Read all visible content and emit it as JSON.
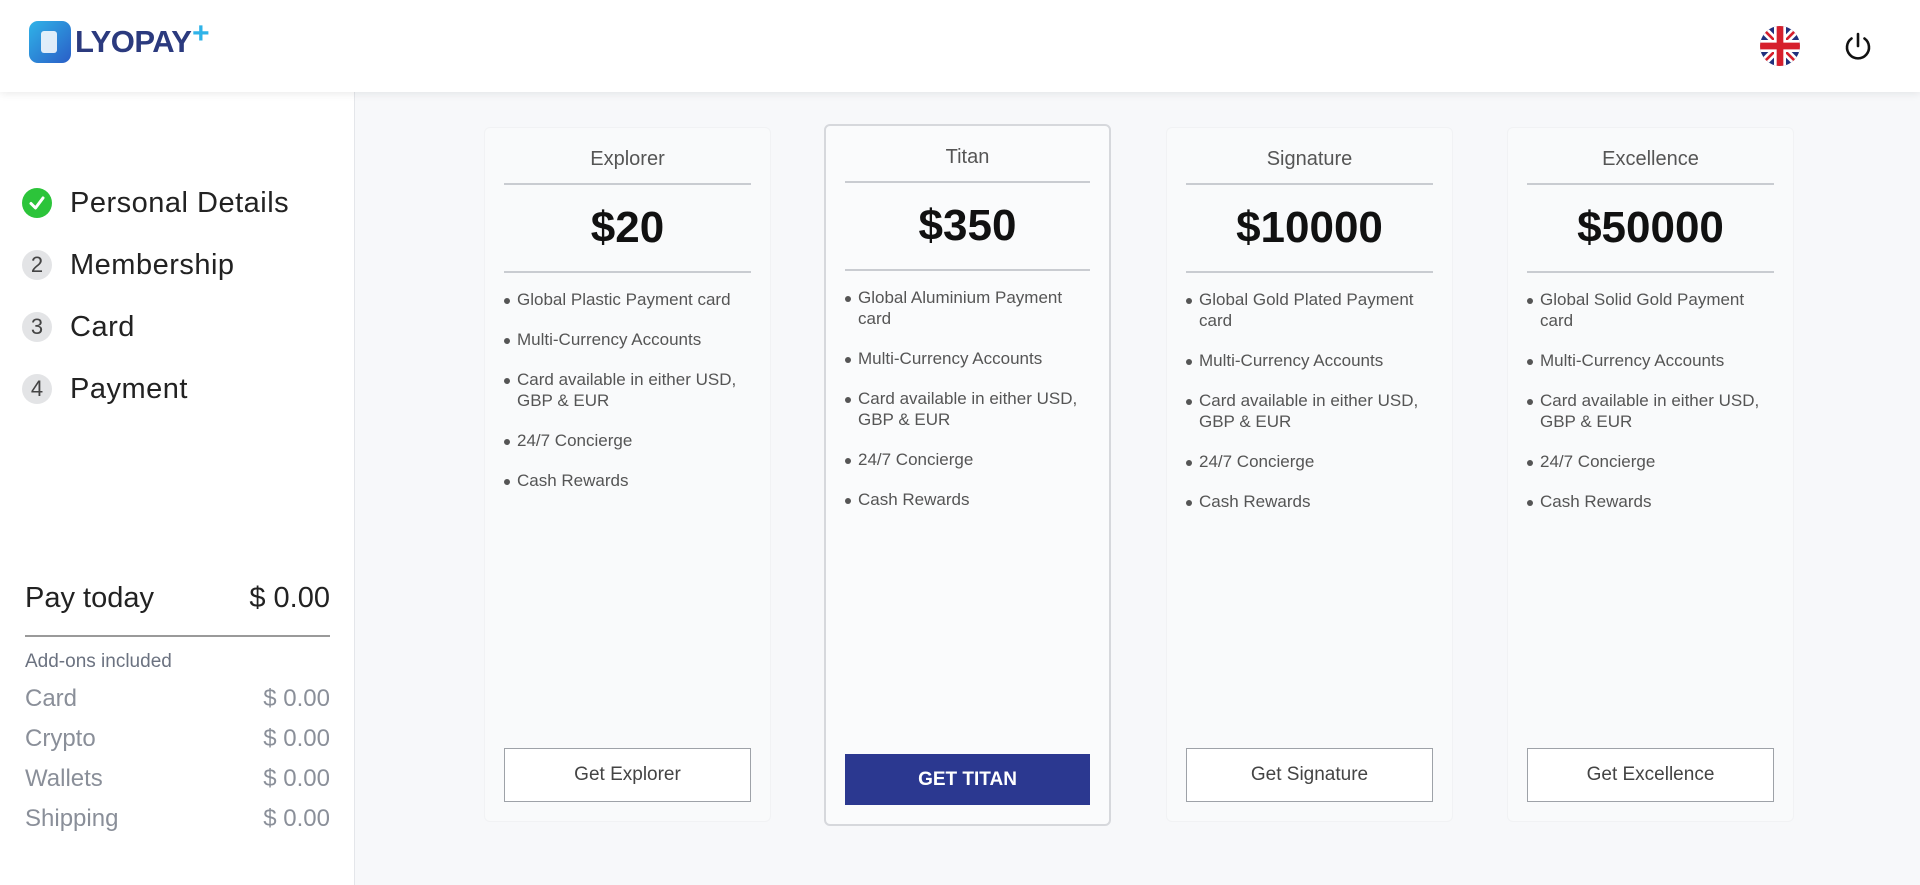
{
  "header": {
    "brand": "LYOPAY",
    "brand_plus": "+",
    "language_icon": "uk-flag-icon",
    "power_icon": "power-icon"
  },
  "sidebar": {
    "steps": [
      {
        "number": "1",
        "label": "Personal Details",
        "status": "completed"
      },
      {
        "number": "2",
        "label": "Membership",
        "status": "pending"
      },
      {
        "number": "3",
        "label": "Card",
        "status": "pending"
      },
      {
        "number": "4",
        "label": "Payment",
        "status": "pending"
      }
    ],
    "pay_today": {
      "label": "Pay today",
      "amount": "$ 0.00"
    },
    "addons_label": "Add-ons included",
    "addons": [
      {
        "label": "Card",
        "amount": "$ 0.00"
      },
      {
        "label": "Crypto",
        "amount": "$ 0.00"
      },
      {
        "label": "Wallets",
        "amount": "$ 0.00"
      },
      {
        "label": "Shipping",
        "amount": "$ 0.00"
      }
    ]
  },
  "plans": [
    {
      "name": "Explorer",
      "price": "$20",
      "button": "Get Explorer",
      "featured": false,
      "features": [
        "Global Plastic Payment card",
        "Multi-Currency Accounts",
        "Card available in either USD, GBP & EUR",
        "24/7 Concierge",
        "Cash Rewards"
      ]
    },
    {
      "name": "Titan",
      "price": "$350",
      "button": "GET TITAN",
      "featured": true,
      "features": [
        "Global Aluminium Payment card",
        "Multi-Currency Accounts",
        "Card available in either USD, GBP & EUR",
        "24/7 Concierge",
        "Cash Rewards"
      ]
    },
    {
      "name": "Signature",
      "price": "$10000",
      "button": "Get Signature",
      "featured": false,
      "features": [
        "Global Gold Plated Payment card",
        "Multi-Currency Accounts",
        "Card available in either USD, GBP & EUR",
        "24/7 Concierge",
        "Cash Rewards"
      ]
    },
    {
      "name": "Excellence",
      "price": "$50000",
      "button": "Get Excellence",
      "featured": false,
      "features": [
        "Global Solid Gold Payment card",
        "Multi-Currency Accounts",
        "Card available in either USD, GBP & EUR",
        "24/7 Concierge",
        "Cash Rewards"
      ]
    }
  ],
  "colors": {
    "accent": "#2b3890",
    "check": "#2cc43a",
    "brand_blue": "#2fb3e8"
  }
}
